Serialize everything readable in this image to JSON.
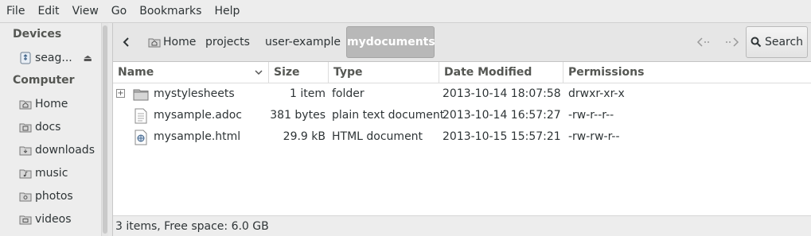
{
  "menubar": {
    "items": [
      "File",
      "Edit",
      "View",
      "Go",
      "Bookmarks",
      "Help"
    ]
  },
  "sidebar": {
    "devices_heading": "Devices",
    "devices": [
      {
        "label": "seag...",
        "icon": "usb-drive-icon"
      }
    ],
    "computer_heading": "Computer",
    "places": [
      {
        "label": "Home",
        "icon": "home-folder-icon"
      },
      {
        "label": "docs",
        "icon": "folder-icon"
      },
      {
        "label": "downloads",
        "icon": "downloads-folder-icon"
      },
      {
        "label": "music",
        "icon": "music-folder-icon"
      },
      {
        "label": "photos",
        "icon": "photos-folder-icon"
      },
      {
        "label": "videos",
        "icon": "videos-folder-icon"
      }
    ]
  },
  "toolbar": {
    "breadcrumbs": [
      "Home",
      "projects",
      "user-example",
      "mydocuments"
    ],
    "search_label": "Search"
  },
  "columns": {
    "name": "Name",
    "size": "Size",
    "type": "Type",
    "date": "Date Modified",
    "permissions": "Permissions"
  },
  "files": [
    {
      "name": "mystylesheets",
      "size": "1 item",
      "type": "folder",
      "date": "2013-10-14 18:07:58",
      "permissions": "drwxr-xr-x",
      "icon": "folder-icon"
    },
    {
      "name": "mysample.adoc",
      "size": "381 bytes",
      "type": "plain text document",
      "date": "2013-10-14 16:57:27",
      "permissions": "-rw-r--r--",
      "icon": "text-file-icon"
    },
    {
      "name": "mysample.html",
      "size": "29.9 kB",
      "type": "HTML document",
      "date": "2013-10-15 15:57:21",
      "permissions": "-rw-rw-r--",
      "icon": "html-file-icon"
    }
  ],
  "status": {
    "text": "3 items, Free space: 6.0 GB"
  },
  "colors": {
    "active_crumb": "#b8b8b8",
    "background": "#ededed"
  }
}
